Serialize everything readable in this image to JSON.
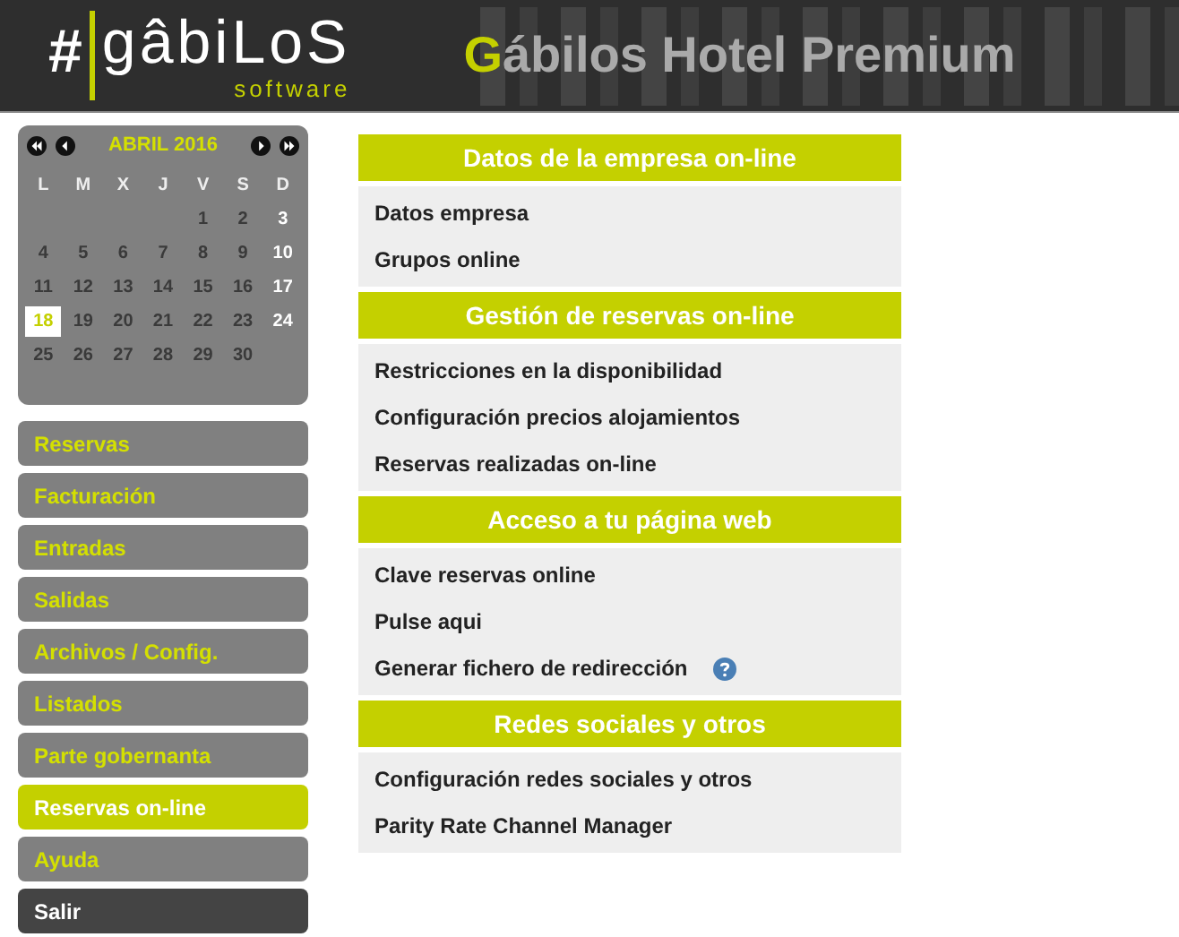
{
  "header": {
    "logo_mark": "#",
    "logo_name": "gâbiLoS",
    "logo_sub": "software",
    "title_initial": "G",
    "title_rest": "ábilos Hotel Premium"
  },
  "calendar": {
    "month": "ABRIL 2016",
    "weekdays": [
      "L",
      "M",
      "X",
      "J",
      "V",
      "S",
      "D"
    ],
    "weeks": [
      [
        {
          "day": "1",
          "selected": false
        },
        {
          "day": "2",
          "selected": false
        },
        {
          "day": "3",
          "selected": false
        }
      ],
      [
        {
          "day": "4",
          "selected": false
        },
        {
          "day": "5",
          "selected": false
        },
        {
          "day": "6",
          "selected": false
        },
        {
          "day": "7",
          "selected": false
        },
        {
          "day": "8",
          "selected": false
        },
        {
          "day": "9",
          "selected": false
        },
        {
          "day": "10",
          "selected": false
        }
      ],
      [
        {
          "day": "11",
          "selected": false
        },
        {
          "day": "12",
          "selected": false
        },
        {
          "day": "13",
          "selected": false
        },
        {
          "day": "14",
          "selected": false
        },
        {
          "day": "15",
          "selected": false
        },
        {
          "day": "16",
          "selected": false
        },
        {
          "day": "17",
          "selected": false
        }
      ],
      [
        {
          "day": "18",
          "selected": true
        },
        {
          "day": "19",
          "selected": false
        },
        {
          "day": "20",
          "selected": false
        },
        {
          "day": "21",
          "selected": false
        },
        {
          "day": "22",
          "selected": false
        },
        {
          "day": "23",
          "selected": false
        },
        {
          "day": "24",
          "selected": false
        }
      ],
      [
        {
          "day": "25",
          "selected": false
        },
        {
          "day": "26",
          "selected": false
        },
        {
          "day": "27",
          "selected": false
        },
        {
          "day": "28",
          "selected": false
        },
        {
          "day": "29",
          "selected": false
        },
        {
          "day": "30",
          "selected": false
        }
      ]
    ]
  },
  "menu": [
    {
      "label": "Reservas",
      "selected": false,
      "kind": "item"
    },
    {
      "label": "Facturación",
      "selected": false,
      "kind": "item"
    },
    {
      "label": "Entradas",
      "selected": false,
      "kind": "item"
    },
    {
      "label": "Salidas",
      "selected": false,
      "kind": "item"
    },
    {
      "label": "Archivos / Config.",
      "selected": false,
      "kind": "item"
    },
    {
      "label": "Listados",
      "selected": false,
      "kind": "item"
    },
    {
      "label": "Parte gobernanta",
      "selected": false,
      "kind": "item"
    },
    {
      "label": "Reservas on-line",
      "selected": true,
      "kind": "item"
    },
    {
      "label": "Ayuda",
      "selected": false,
      "kind": "item"
    },
    {
      "label": "Salir",
      "selected": false,
      "kind": "exit"
    }
  ],
  "sections": [
    {
      "title": "Datos de la empresa on-line",
      "items": [
        {
          "label": "Datos empresa",
          "help": false
        },
        {
          "label": "Grupos online",
          "help": false
        }
      ]
    },
    {
      "title": "Gestión de reservas on-line",
      "items": [
        {
          "label": "Restricciones en la disponibilidad",
          "help": false
        },
        {
          "label": "Configuración precios alojamientos",
          "help": false
        },
        {
          "label": "Reservas realizadas on-line",
          "help": false
        }
      ]
    },
    {
      "title": "Acceso a tu página web",
      "items": [
        {
          "label": "Clave reservas online",
          "help": false
        },
        {
          "label": "Pulse aqui",
          "help": false
        },
        {
          "label": "Generar fichero de redirección",
          "help": true
        }
      ]
    },
    {
      "title": "Redes sociales y otros",
      "items": [
        {
          "label": "Configuración redes sociales y otros",
          "help": false
        },
        {
          "label": "Parity Rate Channel Manager",
          "help": false
        }
      ]
    }
  ]
}
